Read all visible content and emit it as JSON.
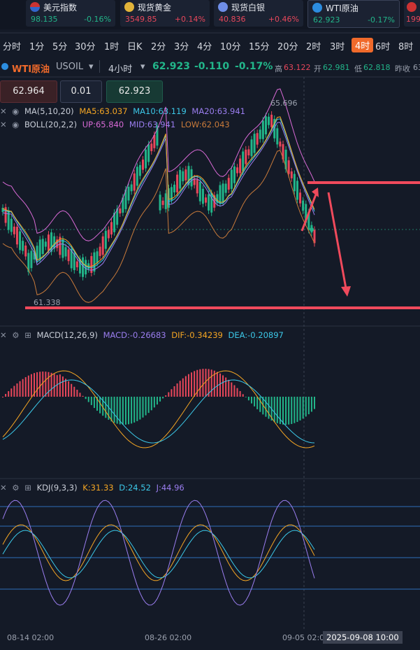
{
  "ticker": [
    {
      "name": "美元指数",
      "price": "98.135",
      "change": "-0.16%",
      "dir": "down",
      "icon": "us-flag-icon"
    },
    {
      "name": "现货黄金",
      "price": "3549.85",
      "change": "+0.14%",
      "dir": "up",
      "icon": "gold-icon"
    },
    {
      "name": "现货白银",
      "price": "40.836",
      "change": "+0.46%",
      "dir": "up",
      "icon": "silver-icon"
    },
    {
      "name": "WTI原油",
      "price": "62.923",
      "change": "-0.17%",
      "dir": "down",
      "icon": "oil-icon"
    }
  ],
  "ticker_partial": "199",
  "timeframes": [
    "分时",
    "1分",
    "5分",
    "30分",
    "1时",
    "日K",
    "2分",
    "3分",
    "4分",
    "10分",
    "15分",
    "20分",
    "2时",
    "3时",
    "4时",
    "6时",
    "8时"
  ],
  "active_timeframe": "4时",
  "symbol": {
    "name": "WTI原油",
    "code": "USOIL",
    "period": "4小时",
    "price": "62.923",
    "change": "-0.110",
    "change_pct": "-0.17%",
    "high_label": "高",
    "high": "63.122",
    "open_label": "开",
    "open": "62.981",
    "low_label": "低",
    "low": "62.818",
    "prev_label": "昨收",
    "prev": "63"
  },
  "order": {
    "sell_price": "62.964",
    "lot": "0.01",
    "buy_price": "62.923"
  },
  "main_indicators": {
    "ma": {
      "label": "MA(5,10,20)",
      "ma5": "MA5:63.037",
      "ma10": "MA10:63.119",
      "ma20": "MA20:63.941"
    },
    "boll": {
      "label": "BOLL(20,2,2)",
      "up": "UP:65.840",
      "mid": "MID:63.941",
      "low": "LOW:62.043"
    }
  },
  "chart_labels": {
    "high_mark": "65.696",
    "low_mark": "61.338"
  },
  "macd": {
    "label": "MACD(12,26,9)",
    "macd": "MACD:-0.26683",
    "dif": "DIF:-0.34239",
    "dea": "DEA:-0.20897"
  },
  "kdj": {
    "label": "KDJ(9,3,3)",
    "k": "K:31.33",
    "d": "D:24.52",
    "j": "J:44.96"
  },
  "x_labels": [
    "08-14 02:00",
    "08-26 02:00",
    "09-05 02:00"
  ],
  "cursor_time": "2025-09-08 10:00",
  "colors": {
    "up": "#e8475b",
    "down": "#22b68a",
    "accent": "#f06a2b",
    "ma5": "#f5a623",
    "ma10": "#3cc8e8",
    "ma20": "#9b7ef0",
    "boll": "#d86ad6",
    "annotation": "#f04a5c"
  }
}
